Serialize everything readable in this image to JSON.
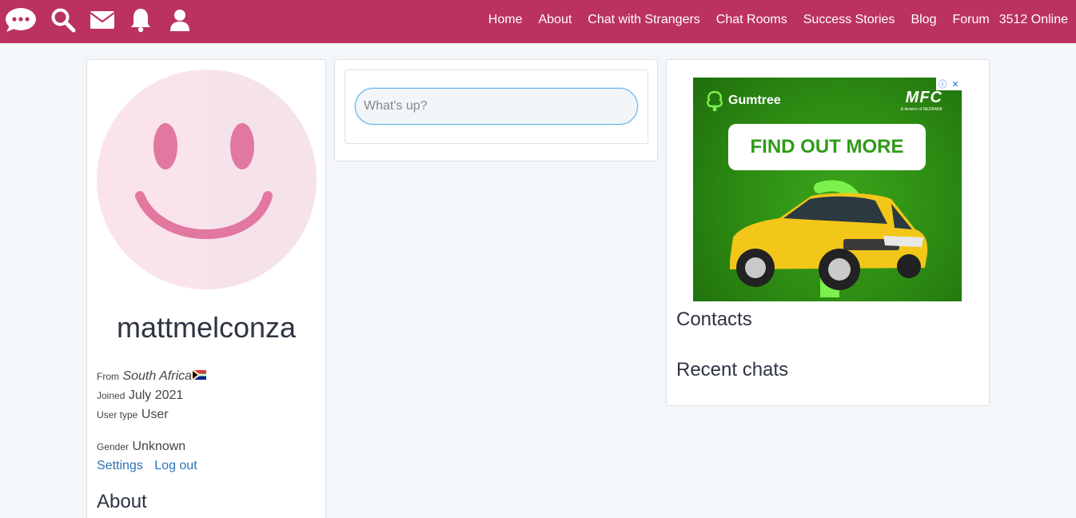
{
  "nav": {
    "icons": [
      "chat-bubble-icon",
      "search-icon",
      "mail-icon",
      "bell-icon",
      "user-icon"
    ],
    "links": [
      "Home",
      "About",
      "Chat with Strangers",
      "Chat Rooms",
      "Success Stories",
      "Blog",
      "Forum"
    ],
    "online_count": "3512 Online"
  },
  "profile": {
    "username": "mattmelconza",
    "from_label": "From",
    "from_value": "South Africa",
    "joined_label": "Joined",
    "joined_value": "July 2021",
    "user_type_label": "User type",
    "user_type_value": "User",
    "gender_label": "Gender",
    "gender_value": "Unknown",
    "settings_link": "Settings",
    "logout_link": "Log out",
    "about_heading": "About"
  },
  "composer": {
    "placeholder": "What's up?"
  },
  "ad": {
    "brand": "Gumtree",
    "partner": "MFC",
    "partner_tagline": "A division of NEDBANK",
    "cta": "FIND OUT MORE"
  },
  "sidebar": {
    "contacts_heading": "Contacts",
    "recent_chats_heading": "Recent chats"
  },
  "colors": {
    "nav_bg": "#bb325e",
    "avatar_face": "#fbe3ec",
    "avatar_features": "#e2779f",
    "link": "#2e73b8",
    "ad_green": "#2c8a12"
  }
}
